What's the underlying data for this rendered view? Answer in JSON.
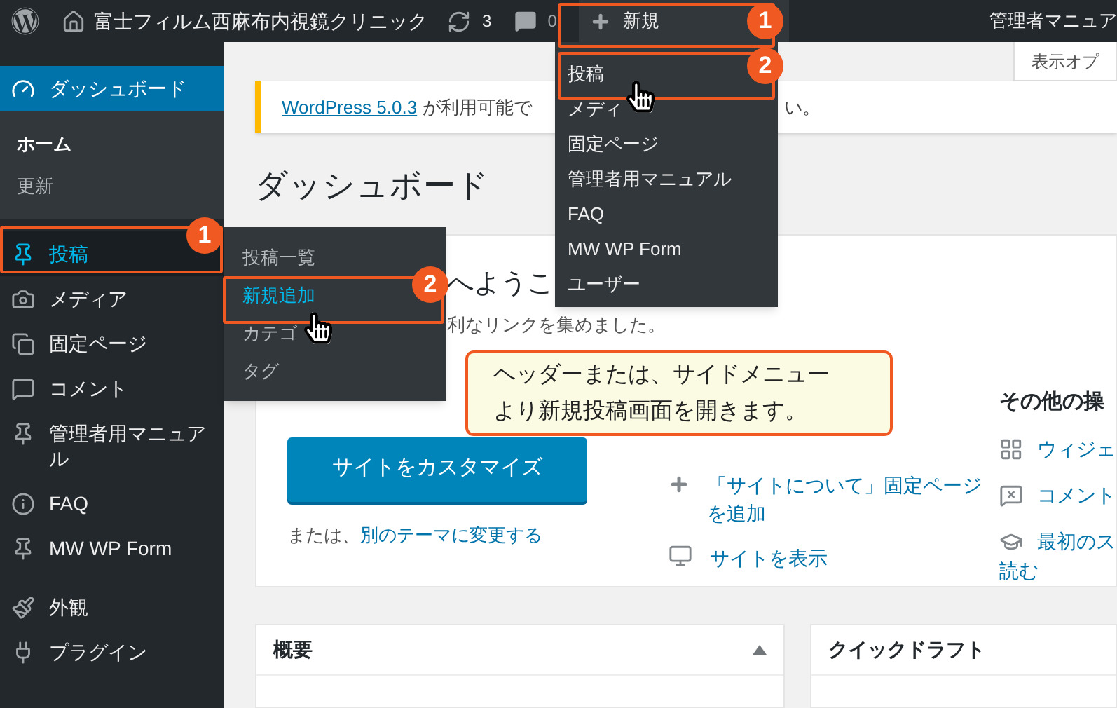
{
  "top_bar": {
    "site_name": "富士フィルム西麻布内視鏡クリニック",
    "updates": "3",
    "comments": "0",
    "new": "新規",
    "user": "管理者マニュア"
  },
  "new_menu": {
    "items": [
      {
        "label": "投稿"
      },
      {
        "label": "メディ"
      },
      {
        "label": "固定ページ"
      },
      {
        "label": "管理者用マニュアル"
      },
      {
        "label": "FAQ"
      },
      {
        "label": "MW WP Form"
      },
      {
        "label": "ユーザー"
      }
    ]
  },
  "sidebar": {
    "items": [
      {
        "label": "ダッシュボード",
        "selected": true,
        "highlighted": false,
        "children": [
          {
            "label": "ホーム",
            "selected": true
          },
          {
            "label": "更新",
            "selected": false
          }
        ]
      },
      {
        "label": "投稿",
        "selected": false,
        "highlighted": true
      },
      {
        "label": "メディア",
        "selected": false,
        "highlighted": false
      },
      {
        "label": "固定ページ",
        "selected": false,
        "highlighted": false
      },
      {
        "label": "コメント",
        "selected": false,
        "highlighted": false
      },
      {
        "label": "管理者用マニュアル",
        "selected": false,
        "highlighted": false
      },
      {
        "label": "FAQ",
        "selected": false,
        "highlighted": false
      },
      {
        "label": "MW WP Form",
        "selected": false,
        "highlighted": false
      },
      {
        "label": "外観",
        "selected": false,
        "highlighted": false
      },
      {
        "label": "プラグイン",
        "selected": false,
        "highlighted": false
      }
    ]
  },
  "posts_flyout": {
    "items": [
      {
        "label": "投稿一覧",
        "highlighted": false
      },
      {
        "label": "新規追加",
        "highlighted": true
      },
      {
        "label": "カテゴ",
        "highlighted": false
      },
      {
        "label": "タグ",
        "highlighted": false
      }
    ]
  },
  "screen_options": "表示オプ",
  "notice": {
    "link": "WordPress 5.0.3",
    "text": "が利用可能で",
    "tail": "い。"
  },
  "page_title": "ダッシュボード",
  "welcome": {
    "title": "へようこ",
    "subtitle": "利なリンクを集めました。",
    "customize_button": "サイトをカスタマイズ",
    "alt_prefix": "または、",
    "alt_link": "別のテーマに変更する",
    "next_steps": [
      {
        "label": "「サイトについて」固定ページを追加"
      },
      {
        "label": "サイトを表示"
      }
    ],
    "more_actions": {
      "title": "その他の操",
      "items": [
        {
          "label": "ウィジェ"
        },
        {
          "label": "コメント"
        },
        {
          "label": "最初のス",
          "continuation": "読む"
        }
      ]
    }
  },
  "panels": [
    {
      "title": "概要",
      "expanded": true
    },
    {
      "title": "クイックドラフト"
    }
  ],
  "callout": [
    "ヘッダーまたは、サイドメニュー",
    "より新規投稿画面を開きます。"
  ],
  "header_markers": [
    "1",
    "2"
  ],
  "sidebar_markers": [
    "1",
    "2"
  ]
}
